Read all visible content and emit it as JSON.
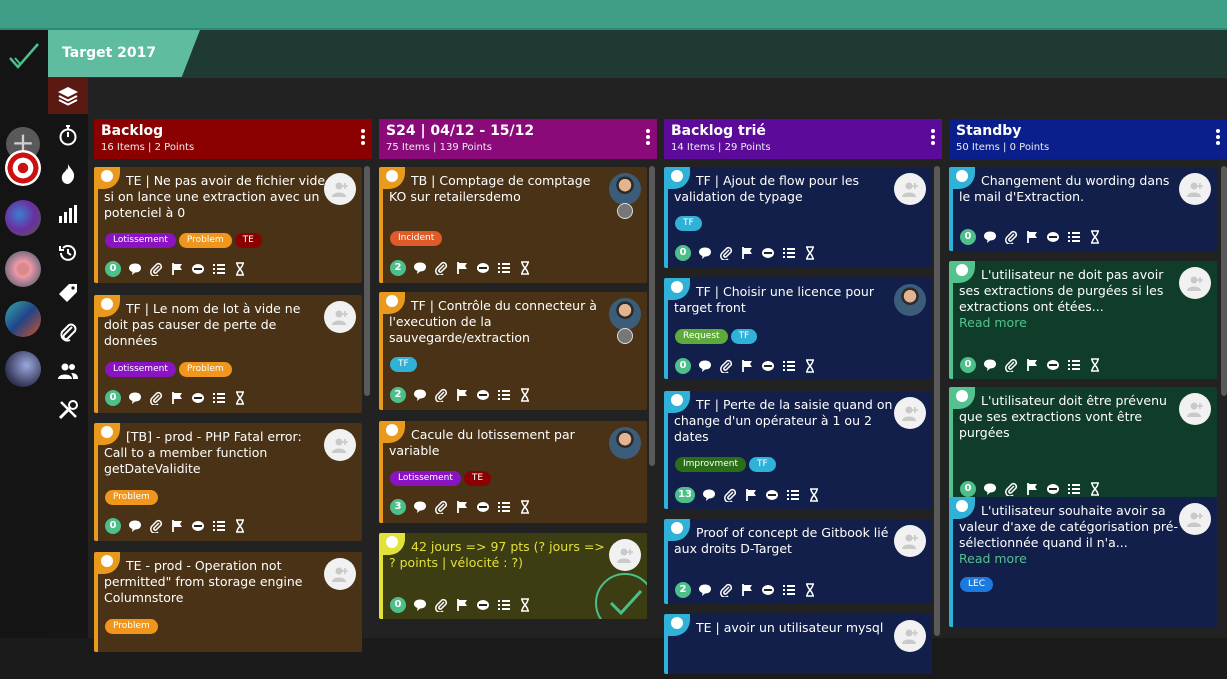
{
  "board": {
    "title": "Target 2017"
  },
  "colors": {
    "accent": "#5fbca0",
    "backlog": "#8b0000",
    "sprint": "#8b0a7a",
    "sorted": "#5c0a9a",
    "standby": "#0a1f8c"
  },
  "columns": [
    {
      "title": "Backlog",
      "stats": "16 Items | 2 Points",
      "cards": [
        {
          "title": "TE | Ne pas avoir de fichier vide si on lance une extraction avec un potenciel à 0",
          "tags": [
            "Lotissement",
            "Problem",
            "TE"
          ],
          "count": "0"
        },
        {
          "title": "TF | Le nom de lot à vide ne doit pas causer de perte de données",
          "tags": [
            "Lotissement",
            "Problem"
          ],
          "count": "0"
        },
        {
          "title": "[TB] - prod - PHP Fatal error: Call to a member function getDateValidite",
          "tags": [
            "Problem"
          ],
          "count": "0"
        },
        {
          "title": "TE - prod - Operation not permitted\" from storage engine Columnstore",
          "tags": [
            "Problem"
          ],
          "count": ""
        }
      ]
    },
    {
      "title": "S24 | 04/12 - 15/12",
      "stats": "75 Items | 139 Points",
      "cards": [
        {
          "title": "TB | Comptage de comptage KO sur retailersdemo",
          "tags": [
            "Incident"
          ],
          "count": "2"
        },
        {
          "title": "TF | Contrôle du connecteur à l'execution de la sauvegarde/extraction",
          "tags": [
            "TF"
          ],
          "count": "2"
        },
        {
          "title": "Cacule du lotissement par variable",
          "tags": [
            "Lotissement",
            "TE"
          ],
          "count": "3"
        },
        {
          "title": "42 jours => 97 pts (? jours => ? points | vélocité : ?)",
          "tags": [],
          "count": "0"
        }
      ]
    },
    {
      "title": "Backlog trié",
      "stats": "14 Items | 29 Points",
      "cards": [
        {
          "title": "TF | Ajout de flow pour les validation de typage",
          "tags": [
            "TF"
          ],
          "count": "0"
        },
        {
          "title": "TF | Choisir une licence pour target front",
          "tags": [
            "Request",
            "TF"
          ],
          "count": "0"
        },
        {
          "title": "TF | Perte de la saisie quand on change d'un opérateur à 1 ou 2 dates",
          "tags": [
            "Improvment",
            "TF"
          ],
          "count": "13"
        },
        {
          "title": "Proof of concept de Gitbook lié aux droits D-Target",
          "tags": [],
          "count": "2"
        },
        {
          "title": "TE | avoir un utilisateur mysql",
          "tags": [],
          "count": ""
        }
      ]
    },
    {
      "title": "Standby",
      "stats": "50 Items | 0 Points",
      "cards": [
        {
          "title": "Changement du wording dans le mail d'Extraction.",
          "tags": [],
          "count": "0"
        },
        {
          "title": "L'utilisateur ne doit pas avoir ses extractions de purgées si les extractions ont étées...",
          "more": "Read more",
          "tags": [],
          "count": "0"
        },
        {
          "title": "L'utilisateur doit être prévenu que ses extractions vont être purgées",
          "tags": [],
          "count": "0"
        },
        {
          "title": "L'utilisateur souhaite avoir sa valeur d'axe de catégorisation pré-sélectionnée quand il n'a...",
          "more": "Read more",
          "tags": [
            "LEC"
          ],
          "count": ""
        }
      ]
    }
  ],
  "icons": [
    "check-logo-icon",
    "plus-icon",
    "layers-icon",
    "stopwatch-icon",
    "fire-icon",
    "bar-chart-icon",
    "history-icon",
    "tag-icon",
    "paperclip-icon",
    "users-icon",
    "tools-icon",
    "kebab-menu-icon",
    "comment-icon",
    "attachment-icon",
    "flag-icon",
    "link-icon",
    "checklist-icon",
    "hourglass-icon",
    "add-user-icon"
  ]
}
